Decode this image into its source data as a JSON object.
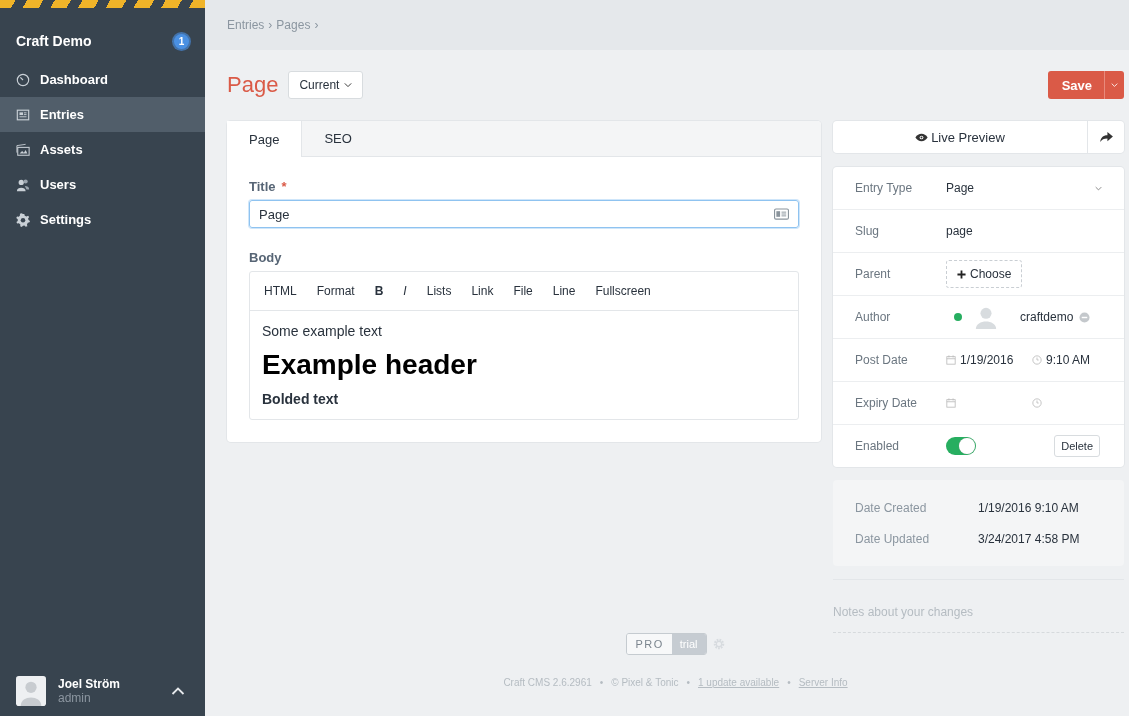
{
  "sidebar": {
    "site_name": "Craft Demo",
    "badge": "1",
    "items": [
      {
        "label": "Dashboard",
        "selected": false
      },
      {
        "label": "Entries",
        "selected": true
      },
      {
        "label": "Assets",
        "selected": false
      },
      {
        "label": "Users",
        "selected": false
      },
      {
        "label": "Settings",
        "selected": false
      }
    ],
    "user": {
      "name": "Joel Ström",
      "role": "admin"
    }
  },
  "breadcrumbs": {
    "separator": "›",
    "items": [
      "Entries",
      "Pages"
    ]
  },
  "header": {
    "title": "Page",
    "revision": "Current",
    "save": "Save"
  },
  "tabs": [
    {
      "label": "Page",
      "selected": true
    },
    {
      "label": "SEO",
      "selected": false
    }
  ],
  "title_field": {
    "label": "Title",
    "required_mark": "*",
    "value": "Page"
  },
  "body_field": {
    "label": "Body",
    "toolbar": [
      {
        "label": "HTML",
        "kind": "text"
      },
      {
        "label": "Format",
        "kind": "text"
      },
      {
        "label": "B",
        "kind": "bold"
      },
      {
        "label": "I",
        "kind": "italic"
      },
      {
        "label": "Lists",
        "kind": "text"
      },
      {
        "label": "Link",
        "kind": "text"
      },
      {
        "label": "File",
        "kind": "text"
      },
      {
        "label": "Line",
        "kind": "text"
      },
      {
        "label": "Fullscreen",
        "kind": "text"
      }
    ],
    "content": [
      {
        "kind": "paragraph",
        "text": "Some example text"
      },
      {
        "kind": "heading",
        "text": "Example header"
      },
      {
        "kind": "bold",
        "text": "Bolded text"
      }
    ]
  },
  "live_preview": "Live Preview",
  "meta": [
    {
      "label": "Entry Type",
      "kind": "select",
      "value": "Page"
    },
    {
      "label": "Slug",
      "kind": "text",
      "value": "page"
    },
    {
      "label": "Parent",
      "kind": "choose",
      "button": "Choose"
    },
    {
      "label": "Author",
      "kind": "author",
      "value": "craftdemo",
      "color": "#27ae60"
    },
    {
      "label": "Post Date",
      "kind": "datetime",
      "date": "1/19/2016",
      "time": "9:10 AM"
    },
    {
      "label": "Expiry Date",
      "kind": "datetime"
    },
    {
      "label": "Enabled",
      "kind": "toggle",
      "on": true,
      "button": "Delete"
    }
  ],
  "dates": [
    {
      "label": "Date Created",
      "value": "1/19/2016 9:10 AM"
    },
    {
      "label": "Date Updated",
      "value": "3/24/2017 4:58 PM"
    }
  ],
  "notes": {
    "placeholder": "Notes about your changes"
  },
  "footer": {
    "edition": "PRO",
    "license": "trial",
    "separator": "•",
    "items": [
      {
        "text": "Craft CMS 2.6.2961",
        "kind": "text"
      },
      {
        "text": "© Pixel & Tonic",
        "kind": "text"
      },
      {
        "text": "1 update available",
        "kind": "link"
      },
      {
        "text": "Server Info",
        "kind": "link"
      }
    ]
  }
}
